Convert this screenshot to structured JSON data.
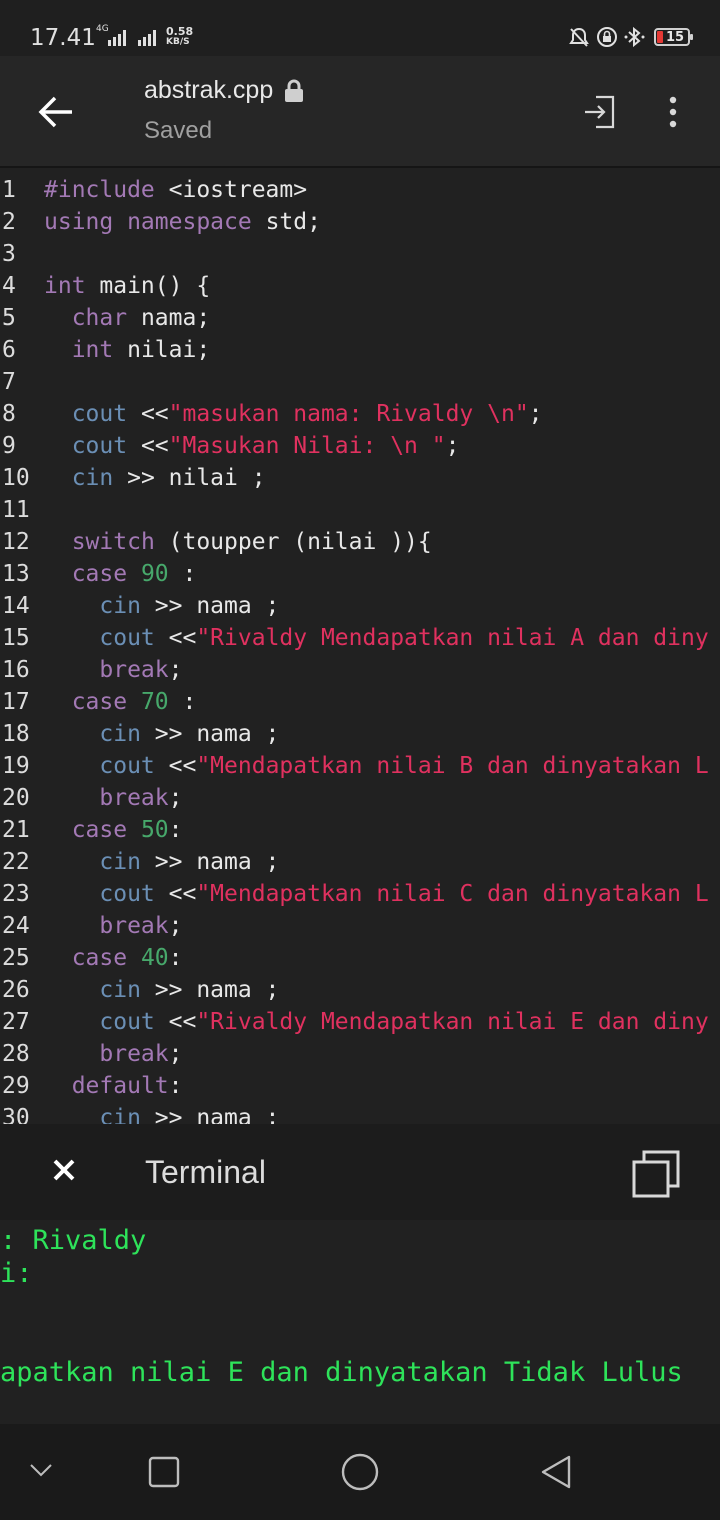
{
  "status_bar": {
    "time": "17.41",
    "network": "4G",
    "speed_value": "0.58",
    "speed_unit": "KB/S",
    "battery": "15"
  },
  "app_bar": {
    "file_name": "abstrak.cpp",
    "status": "Saved"
  },
  "editor": {
    "lines": [
      {
        "n": "1",
        "tokens": [
          {
            "t": "#include",
            "c": "kw"
          },
          {
            "t": " <iostream>",
            "c": ""
          }
        ]
      },
      {
        "n": "2",
        "tokens": [
          {
            "t": "using namespace",
            "c": "kw"
          },
          {
            "t": " std;",
            "c": ""
          }
        ]
      },
      {
        "n": "3",
        "tokens": []
      },
      {
        "n": "4",
        "tokens": [
          {
            "t": "int",
            "c": "kw"
          },
          {
            "t": " main() {",
            "c": ""
          }
        ]
      },
      {
        "n": "5",
        "tokens": [
          {
            "t": "  ",
            "c": ""
          },
          {
            "t": "char",
            "c": "kw"
          },
          {
            "t": " nama;",
            "c": ""
          }
        ]
      },
      {
        "n": "6",
        "tokens": [
          {
            "t": "  ",
            "c": ""
          },
          {
            "t": "int",
            "c": "kw"
          },
          {
            "t": " nilai;",
            "c": ""
          }
        ]
      },
      {
        "n": "7",
        "tokens": []
      },
      {
        "n": "8",
        "tokens": [
          {
            "t": "  ",
            "c": ""
          },
          {
            "t": "cout",
            "c": "io"
          },
          {
            "t": " <<",
            "c": ""
          },
          {
            "t": "\"masukan nama: Rivaldy \\n\"",
            "c": "str"
          },
          {
            "t": ";",
            "c": ""
          }
        ]
      },
      {
        "n": "9",
        "tokens": [
          {
            "t": "  ",
            "c": ""
          },
          {
            "t": "cout",
            "c": "io"
          },
          {
            "t": " <<",
            "c": ""
          },
          {
            "t": "\"Masukan Nilai: \\n \"",
            "c": "str"
          },
          {
            "t": ";",
            "c": ""
          }
        ]
      },
      {
        "n": "10",
        "tokens": [
          {
            "t": "  ",
            "c": ""
          },
          {
            "t": "cin",
            "c": "io"
          },
          {
            "t": " >> nilai ;",
            "c": ""
          }
        ]
      },
      {
        "n": "11",
        "tokens": []
      },
      {
        "n": "12",
        "tokens": [
          {
            "t": "  ",
            "c": ""
          },
          {
            "t": "switch",
            "c": "kw"
          },
          {
            "t": " (toupper (nilai )){",
            "c": ""
          }
        ]
      },
      {
        "n": "13",
        "tokens": [
          {
            "t": "  ",
            "c": ""
          },
          {
            "t": "case",
            "c": "kw"
          },
          {
            "t": " ",
            "c": ""
          },
          {
            "t": "90",
            "c": "num"
          },
          {
            "t": " :",
            "c": ""
          }
        ]
      },
      {
        "n": "14",
        "tokens": [
          {
            "t": "    ",
            "c": ""
          },
          {
            "t": "cin",
            "c": "io"
          },
          {
            "t": " >> nama ;",
            "c": ""
          }
        ]
      },
      {
        "n": "15",
        "tokens": [
          {
            "t": "    ",
            "c": ""
          },
          {
            "t": "cout",
            "c": "io"
          },
          {
            "t": " <<",
            "c": ""
          },
          {
            "t": "\"Rivaldy Mendapatkan nilai A dan diny",
            "c": "str"
          }
        ]
      },
      {
        "n": "16",
        "tokens": [
          {
            "t": "    ",
            "c": ""
          },
          {
            "t": "break",
            "c": "kw"
          },
          {
            "t": ";",
            "c": ""
          }
        ]
      },
      {
        "n": "17",
        "tokens": [
          {
            "t": "  ",
            "c": ""
          },
          {
            "t": "case",
            "c": "kw"
          },
          {
            "t": " ",
            "c": ""
          },
          {
            "t": "70",
            "c": "num"
          },
          {
            "t": " :",
            "c": ""
          }
        ]
      },
      {
        "n": "18",
        "tokens": [
          {
            "t": "    ",
            "c": ""
          },
          {
            "t": "cin",
            "c": "io"
          },
          {
            "t": " >> nama ;",
            "c": ""
          }
        ]
      },
      {
        "n": "19",
        "tokens": [
          {
            "t": "    ",
            "c": ""
          },
          {
            "t": "cout",
            "c": "io"
          },
          {
            "t": " <<",
            "c": ""
          },
          {
            "t": "\"Mendapatkan nilai B dan dinyatakan L",
            "c": "str"
          }
        ]
      },
      {
        "n": "20",
        "tokens": [
          {
            "t": "    ",
            "c": ""
          },
          {
            "t": "break",
            "c": "kw"
          },
          {
            "t": ";",
            "c": ""
          }
        ]
      },
      {
        "n": "21",
        "tokens": [
          {
            "t": "  ",
            "c": ""
          },
          {
            "t": "case",
            "c": "kw"
          },
          {
            "t": " ",
            "c": ""
          },
          {
            "t": "50",
            "c": "num"
          },
          {
            "t": ":",
            "c": ""
          }
        ]
      },
      {
        "n": "22",
        "tokens": [
          {
            "t": "    ",
            "c": ""
          },
          {
            "t": "cin",
            "c": "io"
          },
          {
            "t": " >> nama ;",
            "c": ""
          }
        ]
      },
      {
        "n": "23",
        "tokens": [
          {
            "t": "    ",
            "c": ""
          },
          {
            "t": "cout",
            "c": "io"
          },
          {
            "t": " <<",
            "c": ""
          },
          {
            "t": "\"Mendapatkan nilai C dan dinyatakan L",
            "c": "str"
          }
        ]
      },
      {
        "n": "24",
        "tokens": [
          {
            "t": "    ",
            "c": ""
          },
          {
            "t": "break",
            "c": "kw"
          },
          {
            "t": ";",
            "c": ""
          }
        ]
      },
      {
        "n": "25",
        "tokens": [
          {
            "t": "  ",
            "c": ""
          },
          {
            "t": "case",
            "c": "kw"
          },
          {
            "t": " ",
            "c": ""
          },
          {
            "t": "40",
            "c": "num"
          },
          {
            "t": ":",
            "c": ""
          }
        ]
      },
      {
        "n": "26",
        "tokens": [
          {
            "t": "    ",
            "c": ""
          },
          {
            "t": "cin",
            "c": "io"
          },
          {
            "t": " >> nama ;",
            "c": ""
          }
        ]
      },
      {
        "n": "27",
        "tokens": [
          {
            "t": "    ",
            "c": ""
          },
          {
            "t": "cout",
            "c": "io"
          },
          {
            "t": " <<",
            "c": ""
          },
          {
            "t": "\"Rivaldy Mendapatkan nilai E dan diny",
            "c": "str"
          }
        ]
      },
      {
        "n": "28",
        "tokens": [
          {
            "t": "    ",
            "c": ""
          },
          {
            "t": "break",
            "c": "kw"
          },
          {
            "t": ";",
            "c": ""
          }
        ]
      },
      {
        "n": "29",
        "tokens": [
          {
            "t": "  ",
            "c": ""
          },
          {
            "t": "default",
            "c": "kw"
          },
          {
            "t": ":",
            "c": ""
          }
        ]
      },
      {
        "n": "30",
        "tokens": [
          {
            "t": "    ",
            "c": ""
          },
          {
            "t": "cin",
            "c": "io"
          },
          {
            "t": " >> nama ;",
            "c": ""
          }
        ]
      }
    ]
  },
  "terminal": {
    "title": "Terminal",
    "output": [
      ": Rivaldy",
      "i:",
      "",
      "",
      "apatkan nilai E dan dinyatakan Tidak Lulus"
    ]
  },
  "icons": {
    "back": "arrow-left-icon",
    "run": "login-icon",
    "more": "more-vert-icon",
    "close": "close-icon",
    "copy": "copy-icon",
    "nav_hide": "chevron-down-icon",
    "nav_recents": "square-icon",
    "nav_home": "circle-icon",
    "nav_back": "triangle-back-icon"
  },
  "colors": {
    "keyword": "#a379b5",
    "string": "#e0315f",
    "number": "#47a86b",
    "io": "#6b8fb5",
    "terminal_text": "#2ee35a"
  }
}
